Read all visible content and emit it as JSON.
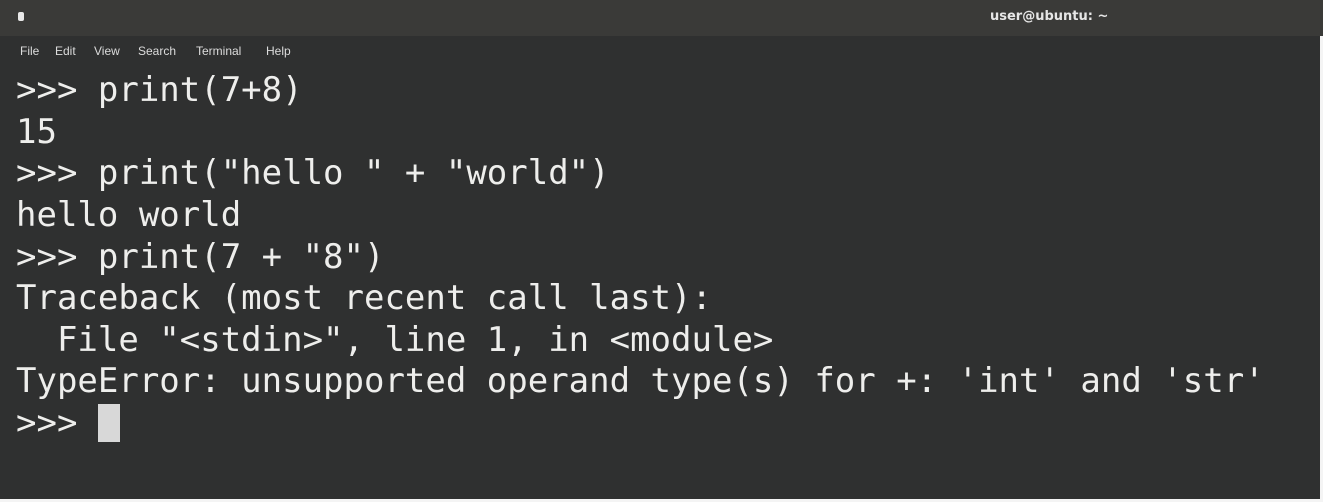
{
  "window": {
    "title": "user@ubuntu: ~",
    "control_icon": "window-menu-icon"
  },
  "menubar": {
    "items": [
      "File",
      "Edit",
      "View",
      "Search",
      "Terminal",
      "Help"
    ]
  },
  "terminal": {
    "lines": [
      ">>> print(7+8)",
      "15",
      ">>> print(\"hello \" + \"world\")",
      "hello world",
      ">>> print(7 + \"8\")",
      "Traceback (most recent call last):",
      "  File \"<stdin>\", line 1, in <module>",
      "TypeError: unsupported operand type(s) for +: 'int' and 'str'",
      ">>> "
    ],
    "cursor_icon": "block-cursor"
  },
  "colors": {
    "background": "#2f3030",
    "titlebar": "#3a3a38",
    "text": "#eeeeec"
  }
}
